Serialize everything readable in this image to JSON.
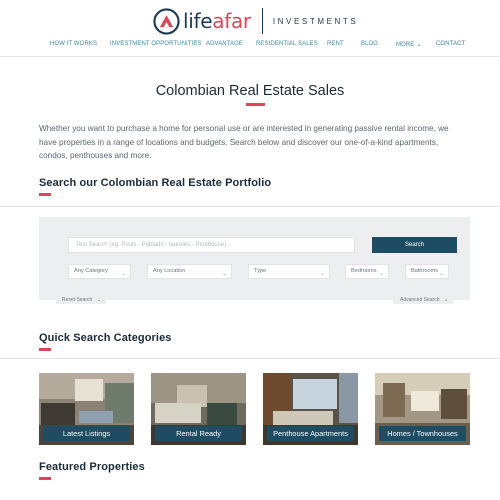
{
  "brand": {
    "name_main": "life",
    "name_accent": "afar",
    "sub": "INVESTMENTS",
    "colors": {
      "navy": "#1e3a52",
      "accent": "#d44a5a",
      "nav": "#3b8a9e"
    }
  },
  "nav": [
    "HOW IT WORKS",
    "INVESTMENT OPPORTUNITIES",
    "ADVANTAGE",
    "RESIDENTIAL SALES",
    "RENT",
    "BLOG",
    "MORE",
    "CONTACT"
  ],
  "page_title": "Colombian Real Estate Sales",
  "intro": "Whether you want to purchase a home for personal use or are interested in generating passive rental income, we have properties in a range of locations and budgets. Search below and discover our one-of-a-kind apartments, condos, penthouses and more.",
  "search_section": {
    "title": "Search our Colombian Real Estate Portfolio",
    "placeholder": "Text Search (eg: Pools - Poblado - laureles - Penthouse)...",
    "button": "Search",
    "filters": [
      "Any Category",
      "Any Location",
      "Type",
      "Bedrooms",
      "Bathrooms"
    ],
    "reset": "Reset Search",
    "advanced": "Advanced Search"
  },
  "quick_section": {
    "title": "Quick Search Categories",
    "categories": [
      "Latest Listings",
      "Rental Ready",
      "Penthouse Apartments",
      "Homes / Townhouses"
    ]
  },
  "featured_title": "Featured Properties"
}
